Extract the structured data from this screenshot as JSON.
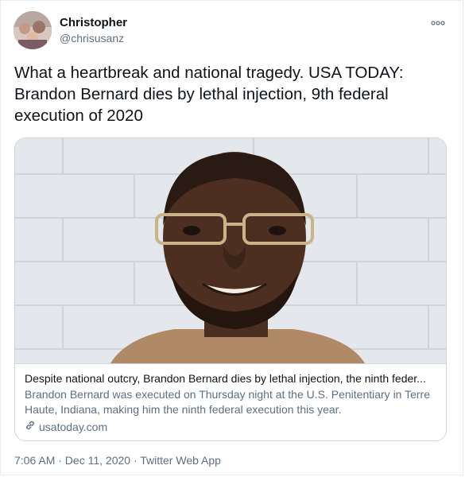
{
  "author": {
    "name": "Christopher",
    "handle": "@chrisusanz"
  },
  "tweet": {
    "text": "What a heartbreak and national tragedy. USA TODAY: Brandon Bernard dies by lethal injection, 9th federal execution of 2020"
  },
  "card": {
    "title": "Despite national outcry, Brandon Bernard dies by lethal injection, the ninth feder...",
    "description": "Brandon Bernard was executed on Thursday night at the U.S. Penitentiary in Terre Haute, Indiana, making him the ninth federal execution this year.",
    "domain": "usatoday.com"
  },
  "meta": {
    "text": "7:06 AM · Dec 11, 2020 · Twitter Web App"
  },
  "colors": {
    "primary_text": "#0f1419",
    "secondary_text": "#5b7083",
    "border": "#ccd6dd"
  },
  "icons": [
    "more-icon",
    "link-icon"
  ]
}
